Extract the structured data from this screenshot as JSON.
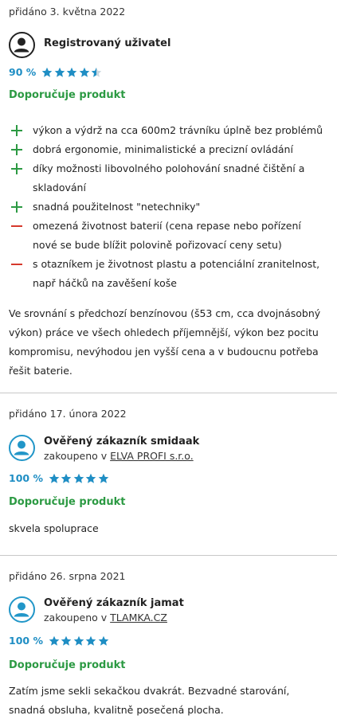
{
  "reviews": [
    {
      "date": "přidáno 3. května 2022",
      "user_name": "Registrovaný uživatel",
      "user_sub": "",
      "shop": "",
      "rating_pct": "90 %",
      "rating_value": 4.5,
      "recommend": "Doporučuje produkt",
      "pros": [
        "výkon a výdrž na cca 600m2 trávníku úplně bez problémů",
        "dobrá ergonomie, minimalistické a precizní ovládání",
        "díky možnosti libovolného polohování snadné čištění a skladování",
        "snadná použitelnost \"netechniky\""
      ],
      "cons": [
        "omezená životnost baterií (cena repase nebo pořízení nové se bude blížit polovině pořizovací ceny setu)",
        "s otazníkem je životnost plastu a potenciální zranitelnost, např háčků na zavěšení koše"
      ],
      "text": "Ve srovnání s předchozí benzínovou (š53 cm, cca dvojnásobný výkon) práce ve všech ohledech příjemnější, výkon bez pocitu kompromisu, nevýhodou jen vyšší cena a v budoucnu potřeba řešit baterie."
    },
    {
      "date": "přidáno 17. února 2022",
      "user_name": "Ověřený zákazník smidaak",
      "user_sub": "zakoupeno v",
      "shop": "ELVA PROFI s.r.o.",
      "rating_pct": "100 %",
      "rating_value": 5,
      "recommend": "Doporučuje produkt",
      "text": "skvela spoluprace"
    },
    {
      "date": "přidáno 26. srpna 2021",
      "user_name": "Ověřený zákazník jamat",
      "user_sub": "zakoupeno v",
      "shop": "TLAMKA.CZ",
      "rating_pct": "100 %",
      "rating_value": 5,
      "recommend": "Doporučuje produkt",
      "text": "Zatím jsme sekli sekačkou dvakrát. Bezvadné starování, snadná obsluha, kvalitně posečená plocha."
    }
  ],
  "colors": {
    "accent_blue": "#1f8ec4",
    "recommend_green": "#2c9a43",
    "minus_red": "#d6382c",
    "star_empty": "#c9d6de"
  }
}
